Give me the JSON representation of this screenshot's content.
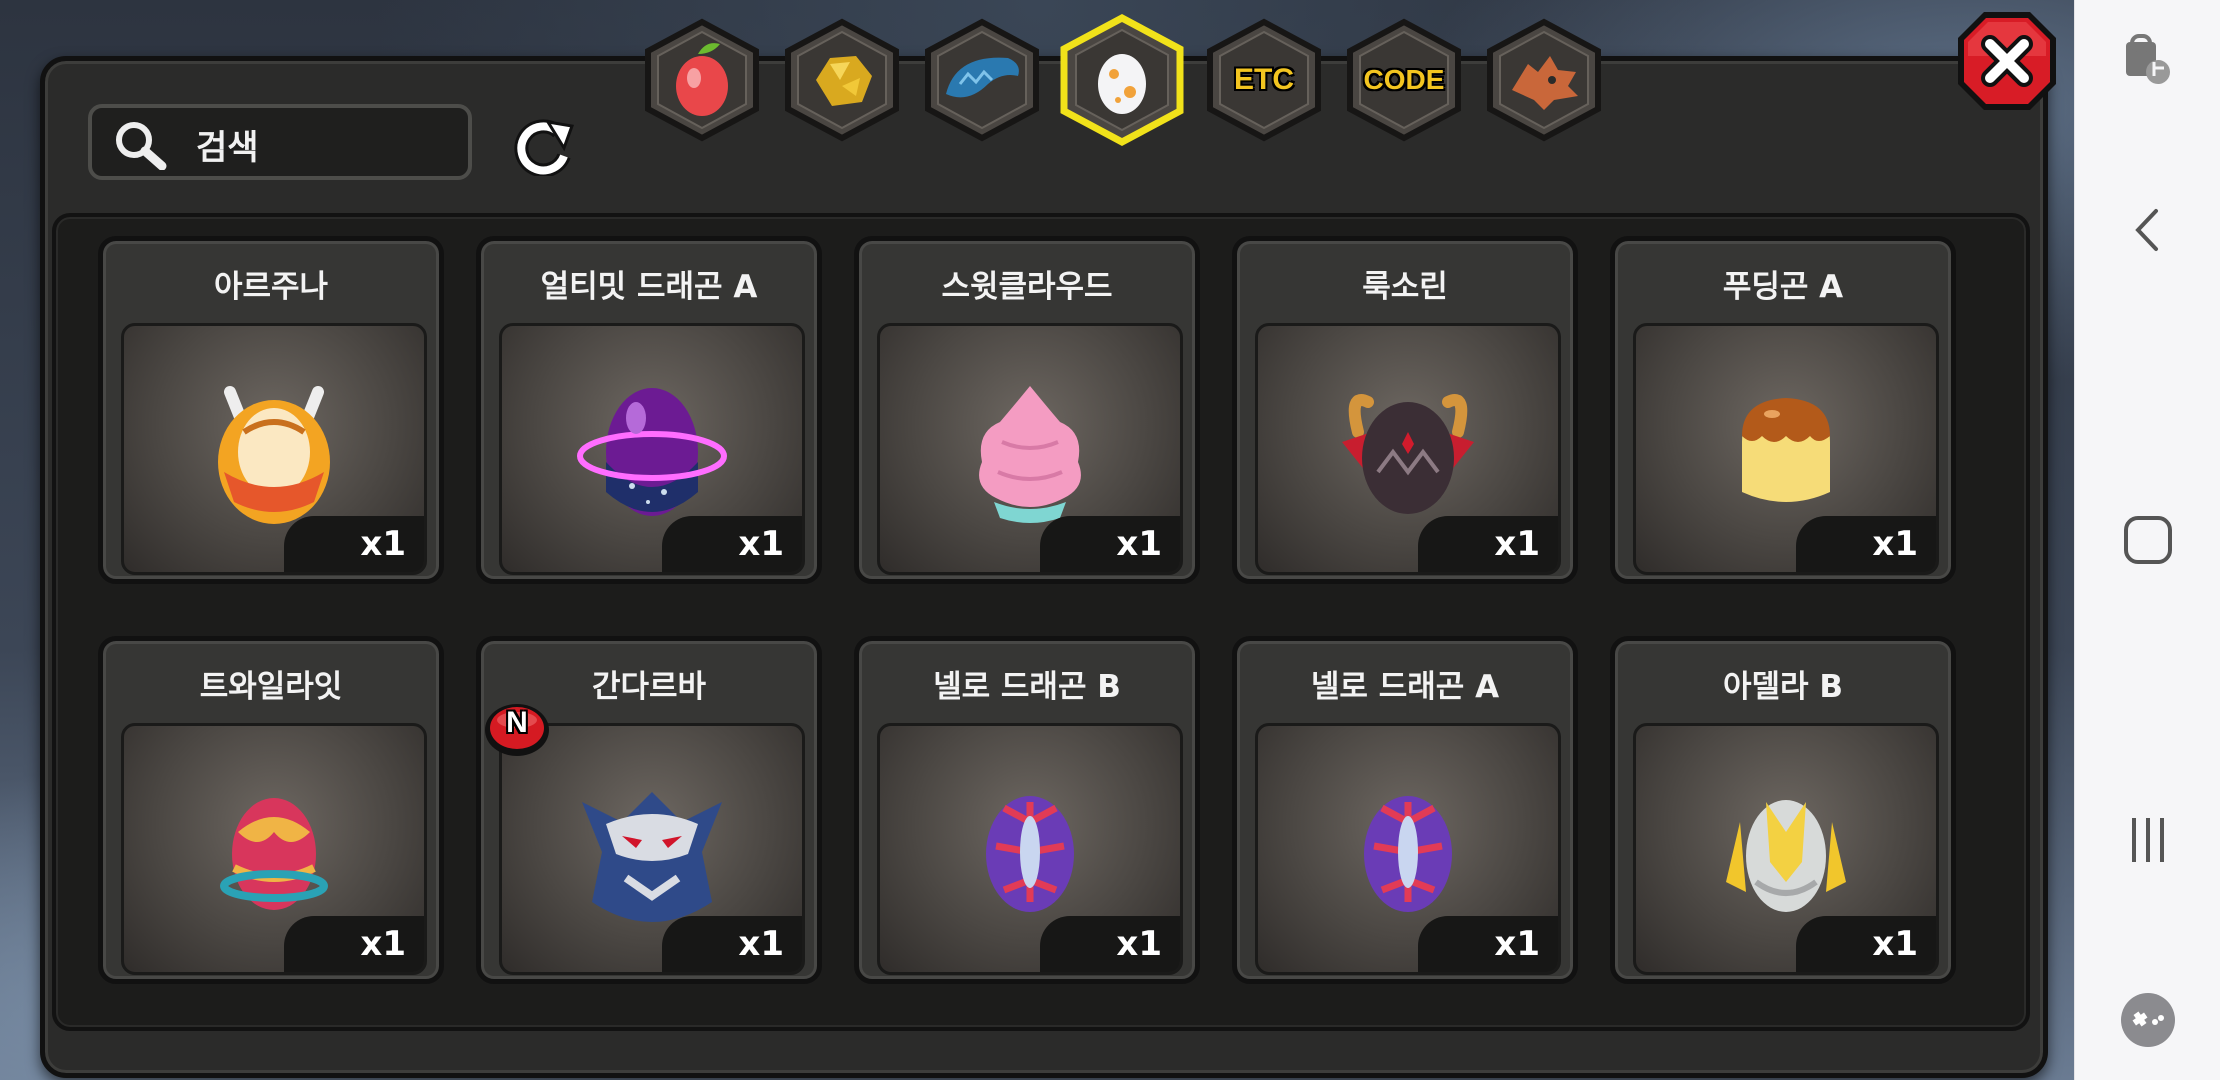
{
  "search": {
    "placeholder": "검색"
  },
  "tabs": [
    {
      "name": "tab-fruit",
      "icon": "fruit-icon"
    },
    {
      "name": "tab-gold",
      "icon": "gold-ore-icon"
    },
    {
      "name": "tab-dragon-scale",
      "icon": "dragon-scale-icon"
    },
    {
      "name": "tab-egg",
      "icon": "egg-icon",
      "selected": true
    },
    {
      "name": "tab-etc",
      "label": "ETC"
    },
    {
      "name": "tab-code",
      "label": "CODE"
    },
    {
      "name": "tab-dragon",
      "icon": "dragon-head-icon"
    }
  ],
  "items": [
    {
      "name": "아르주나",
      "qty": "x1",
      "icon": "arjuna-egg-icon"
    },
    {
      "name": "얼티밋 드래곤 A",
      "qty": "x1",
      "icon": "ultimate-dragon-egg-icon"
    },
    {
      "name": "스윗클라우드",
      "qty": "x1",
      "icon": "sweetcloud-egg-icon"
    },
    {
      "name": "룩소린",
      "qty": "x1",
      "icon": "luxorin-egg-icon"
    },
    {
      "name": "푸딩곤 A",
      "qty": "x1",
      "icon": "pudding-egg-icon"
    },
    {
      "name": "트와일라잇",
      "qty": "x1",
      "icon": "twilight-egg-icon"
    },
    {
      "name": "간다르바",
      "qty": "x1",
      "icon": "gandharva-egg-icon",
      "new_badge": "N"
    },
    {
      "name": "넬로 드래곤 B",
      "qty": "x1",
      "icon": "nello-dragon-egg-icon"
    },
    {
      "name": "넬로 드래곤 A",
      "qty": "x1",
      "icon": "nello-dragon-egg-icon"
    },
    {
      "name": "아델라 B",
      "qty": "x1",
      "icon": "adella-egg-icon"
    }
  ],
  "colors": {
    "selected_tab": "#f1e21a",
    "tab_text": "#f3c520",
    "close": "#d81c26"
  }
}
